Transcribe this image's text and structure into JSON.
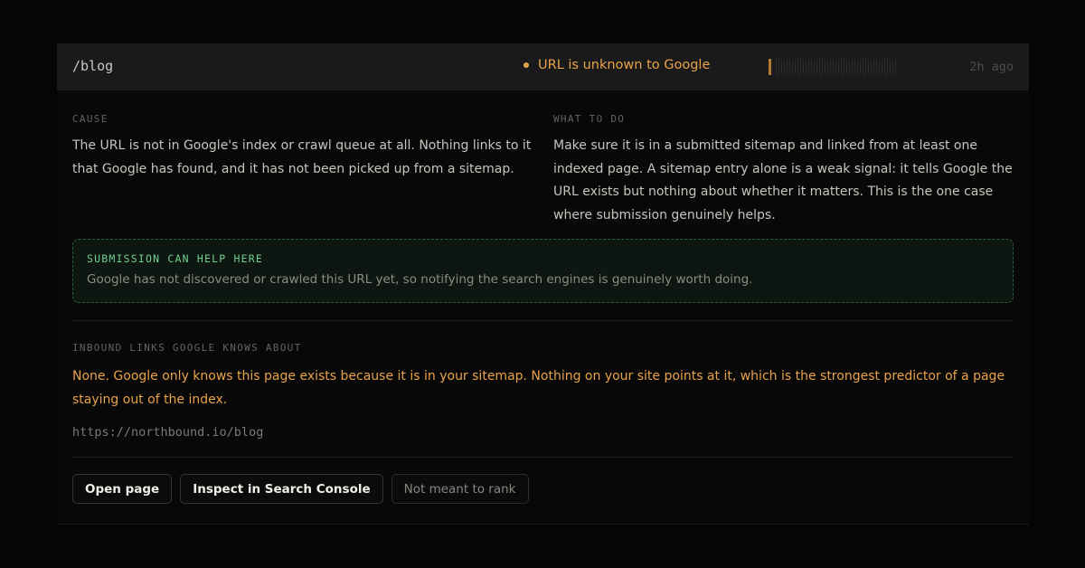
{
  "header": {
    "path": "/blog",
    "status": "URL is unknown to Google",
    "age": "2h ago"
  },
  "cause": {
    "label": "CAUSE",
    "text": "The URL is not in Google's index or crawl queue at all. Nothing links to it that Google has found, and it has not been picked up from a sitemap."
  },
  "todo": {
    "label": "WHAT TO DO",
    "text": "Make sure it is in a submitted sitemap and linked from at least one indexed page. A sitemap entry alone is a weak signal: it tells Google the URL exists but nothing about whether it matters. This is the one case where submission genuinely helps."
  },
  "notice": {
    "title": "SUBMISSION CAN HELP HERE",
    "text": "Google has not discovered or crawled this URL yet, so notifying the search engines is genuinely worth doing."
  },
  "inbound": {
    "label": "INBOUND LINKS GOOGLE KNOWS ABOUT",
    "text": "None. Google only knows this page exists because it is in your sitemap. Nothing on your site points at it, which is the strongest predictor of a page staying out of the index.",
    "url": "https://northbound.io/blog"
  },
  "actions": {
    "open": "Open page",
    "inspect": "Inspect in Search Console",
    "not_rank": "Not meant to rank"
  },
  "colors": {
    "accent": "#e8a24a",
    "success": "#6fcf8e"
  }
}
